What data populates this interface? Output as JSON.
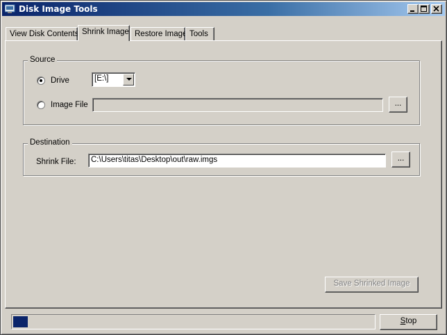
{
  "window": {
    "title": "Disk Image Tools"
  },
  "tabs": [
    {
      "label": "View Disk Contents",
      "active": false
    },
    {
      "label": "Shrink Image",
      "active": true
    },
    {
      "label": "Restore Image",
      "active": false
    },
    {
      "label": "Tools",
      "active": false
    }
  ],
  "source": {
    "legend": "Source",
    "drive_label": "Drive",
    "drive_selected": true,
    "drive_value": "[E:\\]",
    "image_file_label": "Image File",
    "image_file_selected": false,
    "image_file_value": "",
    "browse_label": "..."
  },
  "destination": {
    "legend": "Destination",
    "shrink_file_label": "Shrink File:",
    "shrink_file_value": "C:\\Users\\titas\\Desktop\\out\\raw.imgs",
    "browse_label": "..."
  },
  "actions": {
    "save_label": "Save Shrinked Image",
    "save_enabled": false,
    "stop_label": "Stop",
    "stop_accel": "S",
    "stop_rest": "top"
  },
  "progress": {
    "fraction": 0.04
  },
  "icons": {
    "app": "disk-icon",
    "minimize": "minimize-icon",
    "maximize": "maximize-icon",
    "close": "close-icon",
    "dropdown": "chevron-down-icon"
  },
  "colors": {
    "titlebar_start": "#0a246a",
    "titlebar_end": "#a6caf0",
    "face": "#d4d0c8",
    "progress_fill": "#0a246a"
  }
}
